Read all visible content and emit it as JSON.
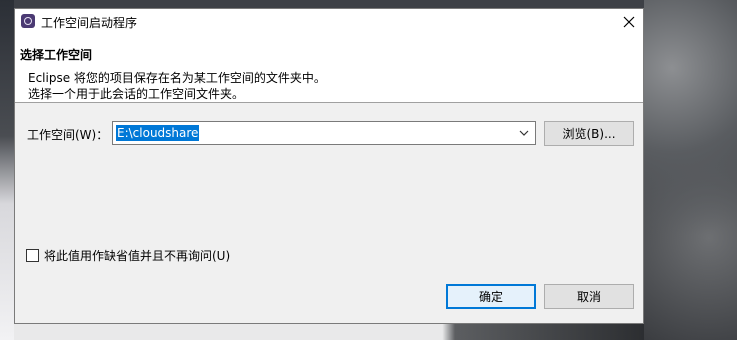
{
  "window": {
    "title": "工作空间启动程序",
    "icon": "eclipse-icon"
  },
  "header": {
    "title": "选择工作空间",
    "description_line1": "Eclipse 将您的项目保存在名为某工作空间的文件夹中。",
    "description_line2": "选择一个用于此会话的工作空间文件夹。"
  },
  "workspace": {
    "label": "工作空间(W)：",
    "value": "E:\\cloudshare",
    "browse_label": "浏览(B)..."
  },
  "options": {
    "default_checkbox_label": "将此值用作缺省值并且不再询问(U)",
    "default_checked": false
  },
  "buttons": {
    "ok_label": "确定",
    "cancel_label": "取消"
  },
  "colors": {
    "accent": "#0078d7",
    "dialog_bg": "#f0f0f0"
  }
}
